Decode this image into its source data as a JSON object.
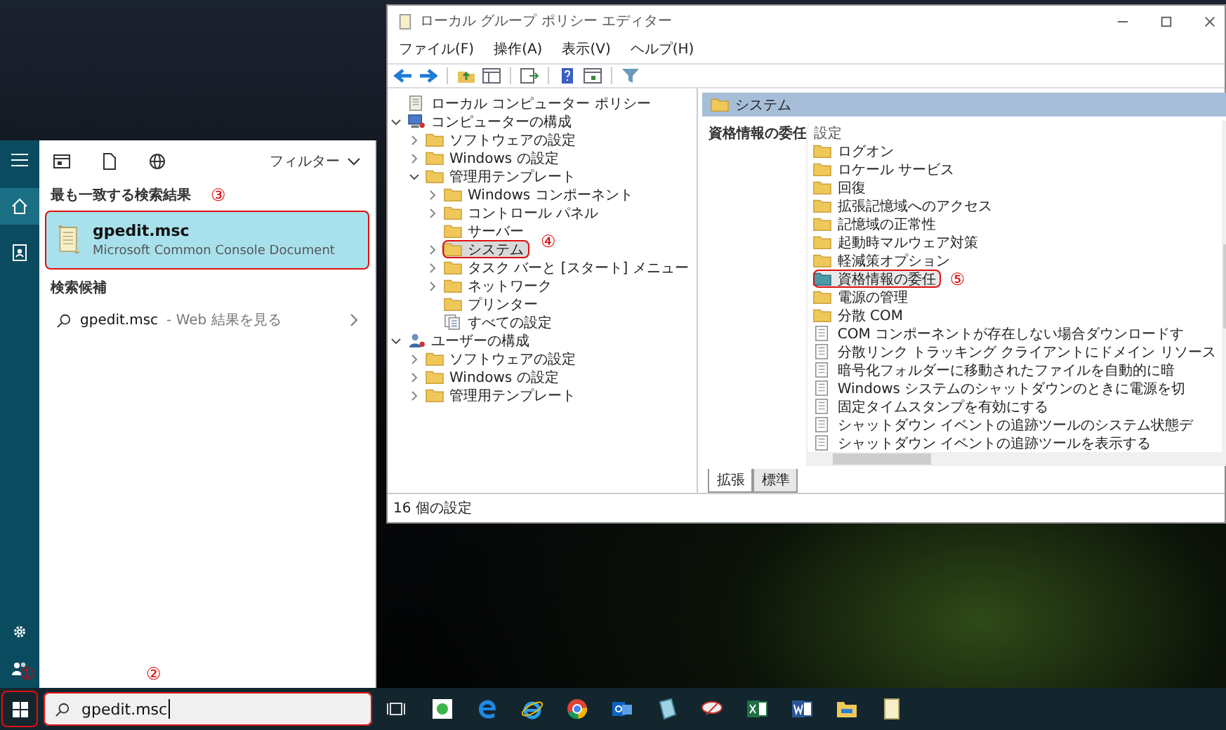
{
  "start_menu": {
    "filter_label": "フィルター",
    "best_match": {
      "heading": "最も一致する検索結果",
      "callout": "③",
      "result": {
        "title": "gpedit.msc",
        "subtitle": "Microsoft Common Console Document",
        "selected": true
      }
    },
    "suggestions": {
      "heading": "検索候補",
      "items": [
        {
          "query": "gpedit.msc",
          "suffix": "- Web 結果を見る"
        }
      ]
    }
  },
  "taskbar": {
    "start_callout": "①",
    "search": {
      "value": "gpedit.msc",
      "callout": "②"
    }
  },
  "gpedit": {
    "title": "ローカル グループ ポリシー エディター",
    "menu": [
      "ファイル(F)",
      "操作(A)",
      "表示(V)",
      "ヘルプ(H)"
    ],
    "tree": [
      {
        "label": "ローカル コンピューター ポリシー",
        "kind": "policy",
        "selected": false,
        "children": [
          {
            "label": "コンピューターの構成",
            "kind": "computer",
            "expanded": true,
            "selected": false,
            "children": [
              {
                "label": "ソフトウェアの設定",
                "kind": "folder",
                "expanded": false,
                "selected": false
              },
              {
                "label": "Windows の設定",
                "kind": "folder",
                "expanded": false,
                "selected": false
              },
              {
                "label": "管理用テンプレート",
                "kind": "folder",
                "expanded": true,
                "selected": false,
                "children": [
                  {
                    "label": "Windows コンポーネント",
                    "kind": "folder",
                    "expanded": false,
                    "selected": false
                  },
                  {
                    "label": "コントロール パネル",
                    "kind": "folder",
                    "expanded": false,
                    "selected": false
                  },
                  {
                    "label": "サーバー",
                    "kind": "folder",
                    "selected": false
                  },
                  {
                    "label": "システム",
                    "kind": "folder",
                    "expanded": false,
                    "selected": true,
                    "callout": "④"
                  },
                  {
                    "label": "タスク バーと [スタート] メニュー",
                    "kind": "folder",
                    "expanded": false,
                    "selected": false
                  },
                  {
                    "label": "ネットワーク",
                    "kind": "folder",
                    "expanded": false,
                    "selected": false
                  },
                  {
                    "label": "プリンター",
                    "kind": "folder",
                    "selected": false
                  },
                  {
                    "label": "すべての設定",
                    "kind": "settings",
                    "selected": false
                  }
                ]
              }
            ]
          },
          {
            "label": "ユーザーの構成",
            "kind": "user",
            "expanded": true,
            "selected": false,
            "children": [
              {
                "label": "ソフトウェアの設定",
                "kind": "folder",
                "expanded": false,
                "selected": false
              },
              {
                "label": "Windows の設定",
                "kind": "folder",
                "expanded": false,
                "selected": false
              },
              {
                "label": "管理用テンプレート",
                "kind": "folder",
                "expanded": false,
                "selected": false
              }
            ]
          }
        ]
      }
    ],
    "pane": {
      "header": "システム",
      "description": "資格情報の委任",
      "column_heading": "設定",
      "items": [
        {
          "kind": "folder",
          "label": "ログオン",
          "selected": false
        },
        {
          "kind": "folder",
          "label": "ロケール サービス",
          "selected": false
        },
        {
          "kind": "folder",
          "label": "回復",
          "selected": false
        },
        {
          "kind": "folder",
          "label": "拡張記憶域へのアクセス",
          "selected": false
        },
        {
          "kind": "folder",
          "label": "記憶域の正常性",
          "selected": false
        },
        {
          "kind": "folder",
          "label": "起動時マルウェア対策",
          "selected": false
        },
        {
          "kind": "folder",
          "label": "軽減策オプション",
          "selected": false
        },
        {
          "kind": "folder",
          "label": "資格情報の委任",
          "selected": true,
          "callout": "⑤"
        },
        {
          "kind": "folder",
          "label": "電源の管理",
          "selected": false
        },
        {
          "kind": "folder",
          "label": "分散 COM",
          "selected": false
        },
        {
          "kind": "setting",
          "label": "COM コンポーネントが存在しない場合ダウンロードす",
          "selected": false
        },
        {
          "kind": "setting",
          "label": "分散リンク トラッキング クライアントにドメイン リソース",
          "selected": false
        },
        {
          "kind": "setting",
          "label": "暗号化フォルダーに移動されたファイルを自動的に暗",
          "selected": false
        },
        {
          "kind": "setting",
          "label": "Windows システムのシャットダウンのときに電源を切",
          "selected": false
        },
        {
          "kind": "setting",
          "label": "固定タイムスタンプを有効にする",
          "selected": false
        },
        {
          "kind": "setting",
          "label": "シャットダウン イベントの追跡ツールのシステム状態デ",
          "selected": false
        },
        {
          "kind": "setting",
          "label": "シャットダウン イベントの追跡ツールを表示する",
          "selected": false
        }
      ]
    },
    "tabs": [
      {
        "label": "拡張",
        "selected": true
      },
      {
        "label": "標準",
        "selected": false
      }
    ],
    "status": "16 個の設定"
  }
}
